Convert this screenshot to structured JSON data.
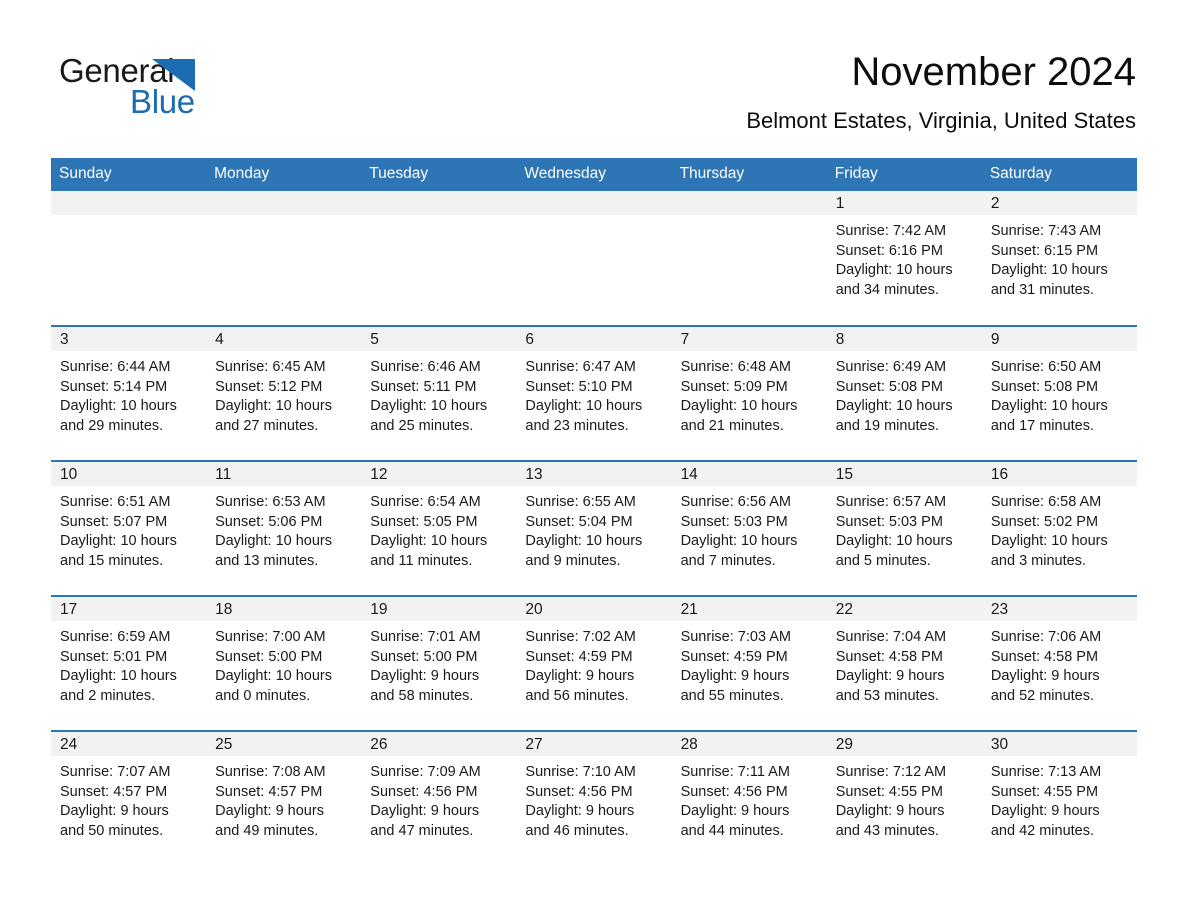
{
  "brand": {
    "name_part1": "General",
    "name_part2": "Blue",
    "triangle_icon": "triangle-icon",
    "accent_color": "#1B6CB0"
  },
  "header": {
    "month_title": "November 2024",
    "location": "Belmont Estates, Virginia, United States"
  },
  "colors": {
    "header_blue": "#2E75B6",
    "daynum_gray": "#F2F2F2",
    "text": "#1a1a1a"
  },
  "weekday_headers": [
    "Sunday",
    "Monday",
    "Tuesday",
    "Wednesday",
    "Thursday",
    "Friday",
    "Saturday"
  ],
  "weeks": [
    [
      {
        "day": "",
        "blank": true,
        "sunrise": "",
        "sunset": "",
        "daylight_line1": "",
        "daylight_line2": ""
      },
      {
        "day": "",
        "blank": true,
        "sunrise": "",
        "sunset": "",
        "daylight_line1": "",
        "daylight_line2": ""
      },
      {
        "day": "",
        "blank": true,
        "sunrise": "",
        "sunset": "",
        "daylight_line1": "",
        "daylight_line2": ""
      },
      {
        "day": "",
        "blank": true,
        "sunrise": "",
        "sunset": "",
        "daylight_line1": "",
        "daylight_line2": ""
      },
      {
        "day": "",
        "blank": true,
        "sunrise": "",
        "sunset": "",
        "daylight_line1": "",
        "daylight_line2": ""
      },
      {
        "day": "1",
        "blank": false,
        "sunrise": "Sunrise: 7:42 AM",
        "sunset": "Sunset: 6:16 PM",
        "daylight_line1": "Daylight: 10 hours",
        "daylight_line2": "and 34 minutes."
      },
      {
        "day": "2",
        "blank": false,
        "sunrise": "Sunrise: 7:43 AM",
        "sunset": "Sunset: 6:15 PM",
        "daylight_line1": "Daylight: 10 hours",
        "daylight_line2": "and 31 minutes."
      }
    ],
    [
      {
        "day": "3",
        "blank": false,
        "sunrise": "Sunrise: 6:44 AM",
        "sunset": "Sunset: 5:14 PM",
        "daylight_line1": "Daylight: 10 hours",
        "daylight_line2": "and 29 minutes."
      },
      {
        "day": "4",
        "blank": false,
        "sunrise": "Sunrise: 6:45 AM",
        "sunset": "Sunset: 5:12 PM",
        "daylight_line1": "Daylight: 10 hours",
        "daylight_line2": "and 27 minutes."
      },
      {
        "day": "5",
        "blank": false,
        "sunrise": "Sunrise: 6:46 AM",
        "sunset": "Sunset: 5:11 PM",
        "daylight_line1": "Daylight: 10 hours",
        "daylight_line2": "and 25 minutes."
      },
      {
        "day": "6",
        "blank": false,
        "sunrise": "Sunrise: 6:47 AM",
        "sunset": "Sunset: 5:10 PM",
        "daylight_line1": "Daylight: 10 hours",
        "daylight_line2": "and 23 minutes."
      },
      {
        "day": "7",
        "blank": false,
        "sunrise": "Sunrise: 6:48 AM",
        "sunset": "Sunset: 5:09 PM",
        "daylight_line1": "Daylight: 10 hours",
        "daylight_line2": "and 21 minutes."
      },
      {
        "day": "8",
        "blank": false,
        "sunrise": "Sunrise: 6:49 AM",
        "sunset": "Sunset: 5:08 PM",
        "daylight_line1": "Daylight: 10 hours",
        "daylight_line2": "and 19 minutes."
      },
      {
        "day": "9",
        "blank": false,
        "sunrise": "Sunrise: 6:50 AM",
        "sunset": "Sunset: 5:08 PM",
        "daylight_line1": "Daylight: 10 hours",
        "daylight_line2": "and 17 minutes."
      }
    ],
    [
      {
        "day": "10",
        "blank": false,
        "sunrise": "Sunrise: 6:51 AM",
        "sunset": "Sunset: 5:07 PM",
        "daylight_line1": "Daylight: 10 hours",
        "daylight_line2": "and 15 minutes."
      },
      {
        "day": "11",
        "blank": false,
        "sunrise": "Sunrise: 6:53 AM",
        "sunset": "Sunset: 5:06 PM",
        "daylight_line1": "Daylight: 10 hours",
        "daylight_line2": "and 13 minutes."
      },
      {
        "day": "12",
        "blank": false,
        "sunrise": "Sunrise: 6:54 AM",
        "sunset": "Sunset: 5:05 PM",
        "daylight_line1": "Daylight: 10 hours",
        "daylight_line2": "and 11 minutes."
      },
      {
        "day": "13",
        "blank": false,
        "sunrise": "Sunrise: 6:55 AM",
        "sunset": "Sunset: 5:04 PM",
        "daylight_line1": "Daylight: 10 hours",
        "daylight_line2": "and 9 minutes."
      },
      {
        "day": "14",
        "blank": false,
        "sunrise": "Sunrise: 6:56 AM",
        "sunset": "Sunset: 5:03 PM",
        "daylight_line1": "Daylight: 10 hours",
        "daylight_line2": "and 7 minutes."
      },
      {
        "day": "15",
        "blank": false,
        "sunrise": "Sunrise: 6:57 AM",
        "sunset": "Sunset: 5:03 PM",
        "daylight_line1": "Daylight: 10 hours",
        "daylight_line2": "and 5 minutes."
      },
      {
        "day": "16",
        "blank": false,
        "sunrise": "Sunrise: 6:58 AM",
        "sunset": "Sunset: 5:02 PM",
        "daylight_line1": "Daylight: 10 hours",
        "daylight_line2": "and 3 minutes."
      }
    ],
    [
      {
        "day": "17",
        "blank": false,
        "sunrise": "Sunrise: 6:59 AM",
        "sunset": "Sunset: 5:01 PM",
        "daylight_line1": "Daylight: 10 hours",
        "daylight_line2": "and 2 minutes."
      },
      {
        "day": "18",
        "blank": false,
        "sunrise": "Sunrise: 7:00 AM",
        "sunset": "Sunset: 5:00 PM",
        "daylight_line1": "Daylight: 10 hours",
        "daylight_line2": "and 0 minutes."
      },
      {
        "day": "19",
        "blank": false,
        "sunrise": "Sunrise: 7:01 AM",
        "sunset": "Sunset: 5:00 PM",
        "daylight_line1": "Daylight: 9 hours",
        "daylight_line2": "and 58 minutes."
      },
      {
        "day": "20",
        "blank": false,
        "sunrise": "Sunrise: 7:02 AM",
        "sunset": "Sunset: 4:59 PM",
        "daylight_line1": "Daylight: 9 hours",
        "daylight_line2": "and 56 minutes."
      },
      {
        "day": "21",
        "blank": false,
        "sunrise": "Sunrise: 7:03 AM",
        "sunset": "Sunset: 4:59 PM",
        "daylight_line1": "Daylight: 9 hours",
        "daylight_line2": "and 55 minutes."
      },
      {
        "day": "22",
        "blank": false,
        "sunrise": "Sunrise: 7:04 AM",
        "sunset": "Sunset: 4:58 PM",
        "daylight_line1": "Daylight: 9 hours",
        "daylight_line2": "and 53 minutes."
      },
      {
        "day": "23",
        "blank": false,
        "sunrise": "Sunrise: 7:06 AM",
        "sunset": "Sunset: 4:58 PM",
        "daylight_line1": "Daylight: 9 hours",
        "daylight_line2": "and 52 minutes."
      }
    ],
    [
      {
        "day": "24",
        "blank": false,
        "sunrise": "Sunrise: 7:07 AM",
        "sunset": "Sunset: 4:57 PM",
        "daylight_line1": "Daylight: 9 hours",
        "daylight_line2": "and 50 minutes."
      },
      {
        "day": "25",
        "blank": false,
        "sunrise": "Sunrise: 7:08 AM",
        "sunset": "Sunset: 4:57 PM",
        "daylight_line1": "Daylight: 9 hours",
        "daylight_line2": "and 49 minutes."
      },
      {
        "day": "26",
        "blank": false,
        "sunrise": "Sunrise: 7:09 AM",
        "sunset": "Sunset: 4:56 PM",
        "daylight_line1": "Daylight: 9 hours",
        "daylight_line2": "and 47 minutes."
      },
      {
        "day": "27",
        "blank": false,
        "sunrise": "Sunrise: 7:10 AM",
        "sunset": "Sunset: 4:56 PM",
        "daylight_line1": "Daylight: 9 hours",
        "daylight_line2": "and 46 minutes."
      },
      {
        "day": "28",
        "blank": false,
        "sunrise": "Sunrise: 7:11 AM",
        "sunset": "Sunset: 4:56 PM",
        "daylight_line1": "Daylight: 9 hours",
        "daylight_line2": "and 44 minutes."
      },
      {
        "day": "29",
        "blank": false,
        "sunrise": "Sunrise: 7:12 AM",
        "sunset": "Sunset: 4:55 PM",
        "daylight_line1": "Daylight: 9 hours",
        "daylight_line2": "and 43 minutes."
      },
      {
        "day": "30",
        "blank": false,
        "sunrise": "Sunrise: 7:13 AM",
        "sunset": "Sunset: 4:55 PM",
        "daylight_line1": "Daylight: 9 hours",
        "daylight_line2": "and 42 minutes."
      }
    ]
  ]
}
